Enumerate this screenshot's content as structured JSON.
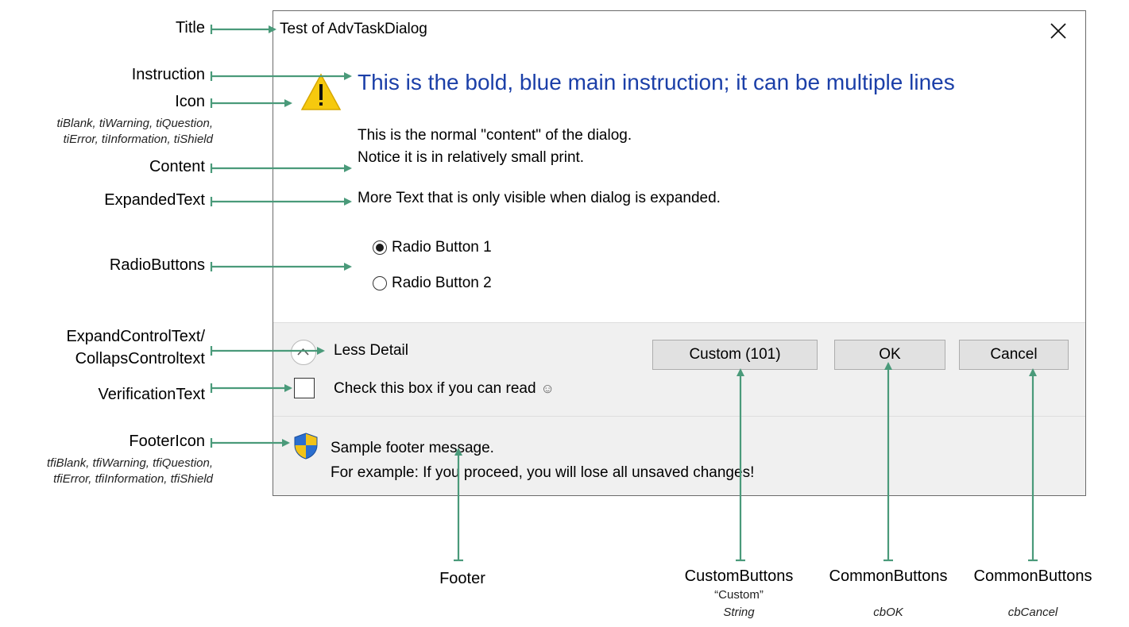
{
  "dialog": {
    "title": "Test of AdvTaskDialog",
    "instruction": "This is the bold, blue main instruction; it can be multiple lines",
    "content_line1": "This is the normal \"content\" of the dialog.",
    "content_line2": "Notice it is in relatively small print.",
    "expanded_text": "More Text that is only visible when dialog is expanded.",
    "radio_buttons": [
      {
        "label": "Radio Button 1",
        "selected": true
      },
      {
        "label": "Radio Button 2",
        "selected": false
      }
    ],
    "expand_control_text": "Less Detail",
    "verification_text": "Check this box if you can read",
    "verification_checked": false,
    "buttons": {
      "custom": "Custom (101)",
      "ok": "OK",
      "cancel": "Cancel"
    },
    "footer_line1": "Sample footer message.",
    "footer_line2": "For example: If you proceed, you will lose all unsaved changes!",
    "icons": {
      "close": "close-icon",
      "main": "warning-icon",
      "footer": "shield-icon",
      "expander": "chevron-up-icon"
    },
    "colors": {
      "instruction": "#1b3fa8",
      "warning_yellow": "#f6c90e",
      "arrow_green": "#4a9a7a"
    }
  },
  "annotations": {
    "title": "Title",
    "instruction": "Instruction",
    "icon": "Icon",
    "icon_values_line1": "tiBlank, tiWarning, tiQuestion,",
    "icon_values_line2": "tiError, tiInformation, tiShield",
    "content": "Content",
    "expanded_text": "ExpandedText",
    "radio_buttons": "RadioButtons",
    "expand_control_line1": "ExpandControlText/",
    "expand_control_line2": "CollapsControltext",
    "verification_text": "VerificationText",
    "footer_icon": "FooterIcon",
    "footer_icon_values_line1": "tfiBlank, tfiWarning, tfiQuestion,",
    "footer_icon_values_line2": "tfiError, tfiInformation, tfiShield",
    "footer": "Footer",
    "custom_buttons": "CustomButtons",
    "custom_buttons_sub1": "“Custom”",
    "custom_buttons_sub2": "String",
    "common_buttons_ok": "CommonButtons",
    "common_buttons_ok_sub": "cbOK",
    "common_buttons_cancel": "CommonButtons",
    "common_buttons_cancel_sub": "cbCancel"
  }
}
